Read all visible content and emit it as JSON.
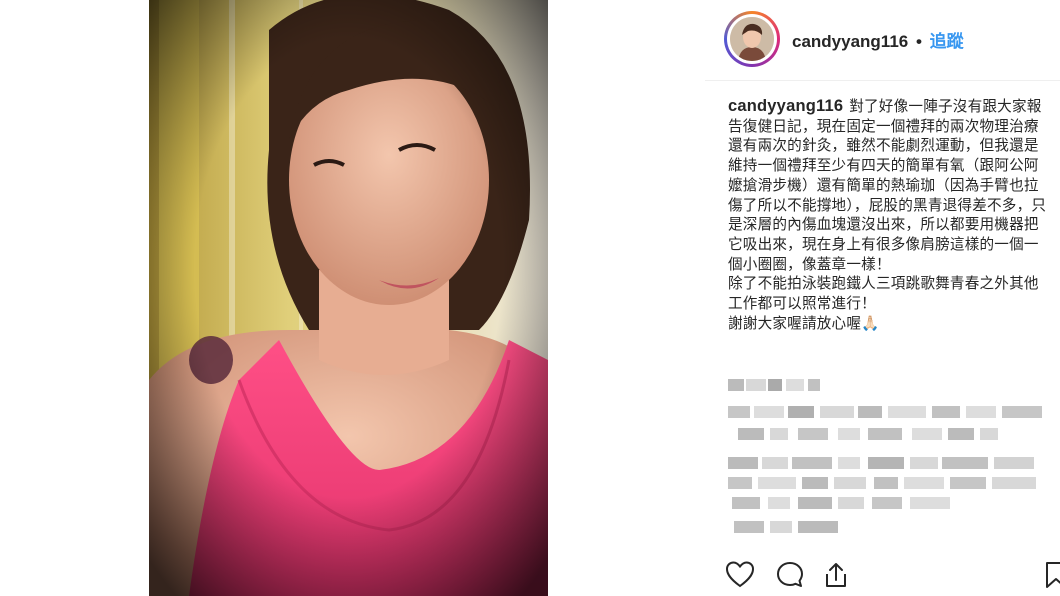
{
  "post": {
    "username": "candyyang116",
    "separator": "•",
    "follow_label": "追蹤",
    "caption_user": "candyyang116",
    "caption_text": "對了好像一陣子沒有跟大家報告復健日記，現在固定一個禮拜的兩次物理治療還有兩次的針灸，雖然不能劇烈運動，但我還是維持一個禮拜至少有四天的簡單有氧（跟阿公阿嬤搶滑步機）還有簡單的熱瑜珈（因為手臂也拉傷了所以不能撐地），屁股的黑青退得差不多，只是深層的內傷血塊還沒出來，所以都要用機器把它吸出來，現在身上有很多像肩膀這樣的一個一個小圈圈，像蓋章一樣！",
    "caption_line2": "除了不能拍泳裝跑鐵人三項跳歌舞青春之外其他工作都可以照常進行！",
    "caption_line3": "謝謝大家喔請放心喔🙏🏻"
  },
  "actions": {
    "like_icon": "heart-icon",
    "comment_icon": "comment-icon",
    "share_icon": "share-icon",
    "save_icon": "bookmark-icon"
  },
  "colors": {
    "follow": "#3897f0",
    "text": "#262626",
    "divider": "#efefef"
  }
}
